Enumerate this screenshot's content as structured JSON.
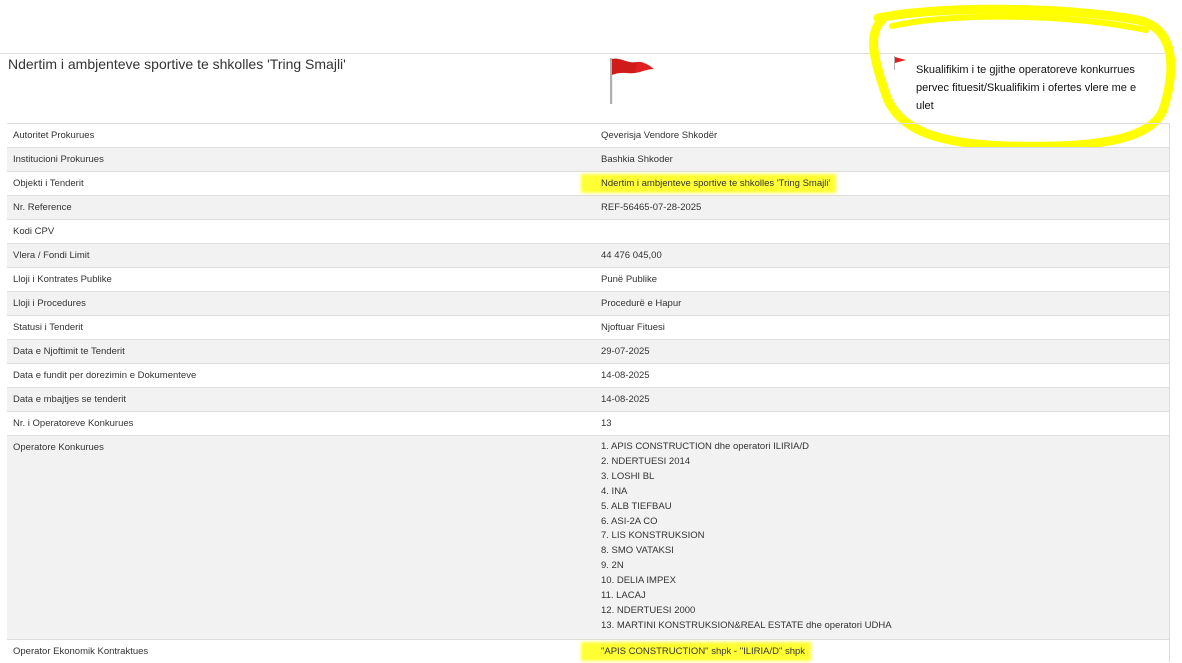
{
  "page": {
    "title": "Ndertim i ambjenteve sportive te shkolles 'Tring Smajli'",
    "status_note": "Skualifikim i te gjithe operatoreve konkurrues pervec fituesit/Skualifikim i ofertes vlere me e ulet",
    "flag_icon": "red-flag-icon",
    "flag_color": "#e02020",
    "highlight_color": "#ffff33"
  },
  "details": {
    "rows": [
      {
        "label": "Autoritet Prokurues",
        "value": "Qeverisja Vendore Shkodër"
      },
      {
        "label": "Institucioni Prokurues",
        "value": "Bashkia Shkoder"
      },
      {
        "label": "Objekti i Tenderit",
        "value": "Ndertim i ambjenteve sportive te shkolles 'Tring Smajli'"
      },
      {
        "label": "Nr. Reference",
        "value": "REF-56465-07-28-2025"
      },
      {
        "label": "Kodi CPV",
        "value": ""
      },
      {
        "label": "Vlera / Fondi Limit",
        "value": "44 476 045,00"
      },
      {
        "label": "Lloji i Kontrates Publike",
        "value": "Punë Publike"
      },
      {
        "label": "Lloji i Procedures",
        "value": "Procedurë e Hapur"
      },
      {
        "label": "Statusi i Tenderit",
        "value": "Njoftuar Fituesi"
      },
      {
        "label": "Data e Njoftimit te Tenderit",
        "value": "29-07-2025"
      },
      {
        "label": "Data e fundit per dorezimin e Dokumenteve",
        "value": "14-08-2025"
      },
      {
        "label": "Data e mbajtjes se tenderit",
        "value": "14-08-2025"
      },
      {
        "label": "Nr. i Operatoreve Konkurues",
        "value": "13"
      }
    ],
    "operators_label": "Operatore Konkurues",
    "operators": [
      "1. APIS CONSTRUCTION dhe operatori ILIRIA/D",
      "2. NDERTUESI 2014",
      "3. LOSHI BL",
      "4. INA",
      "5. ALB TIEFBAU",
      "6. ASI-2A CO",
      "7. LIS KONSTRUKSION",
      "8. SMO VATAKSI",
      "9. 2N",
      "10. DELIA IMPEX",
      "11. LACAJ",
      "12. NDERTUESI 2000",
      "13. MARTINI KONSTRUKSION&REAL ESTATE dhe operatori UDHA"
    ],
    "contractor_label": "Operator Ekonomik Kontraktues",
    "contractor_value": "\"APIS CONSTRUCTION\" shpk - \"ILIRIA/D\" shpk"
  }
}
